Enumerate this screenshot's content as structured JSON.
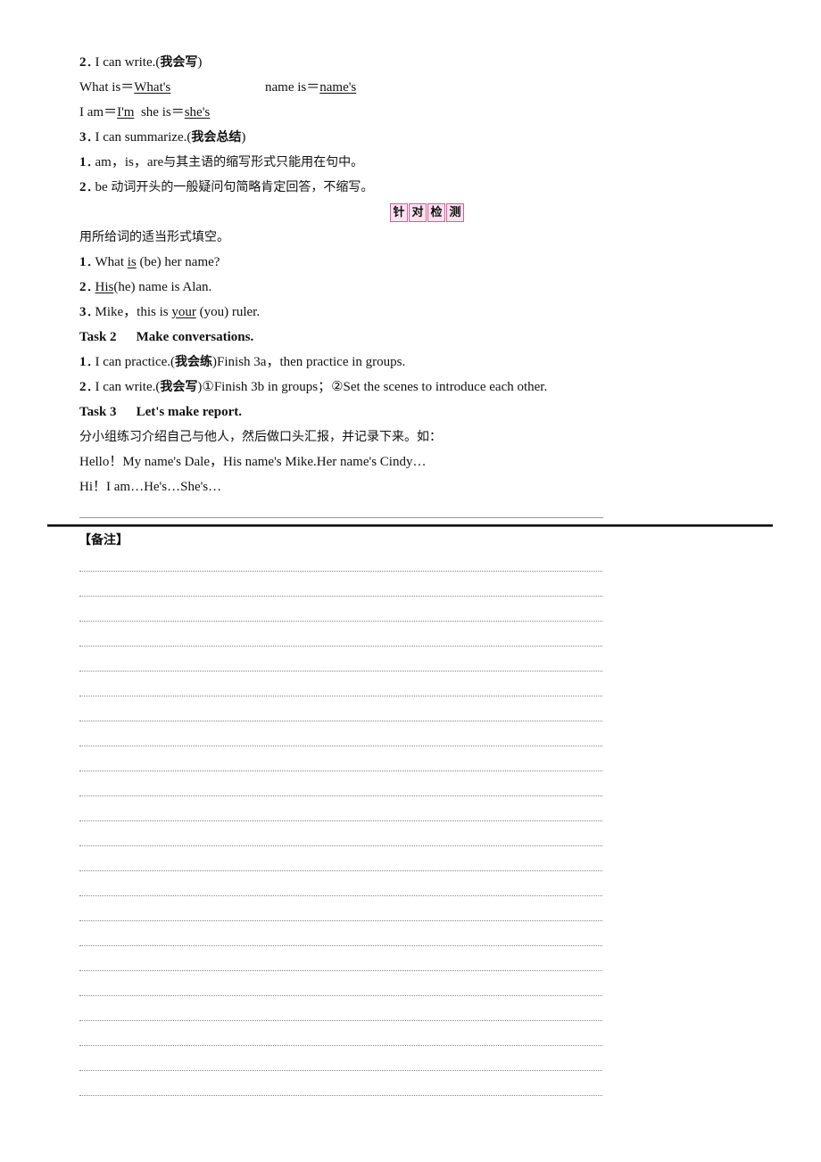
{
  "section_write": {
    "num": "2",
    "label": "I can write.(",
    "label_cn": "我会写",
    "label_end": ")",
    "pairs_row1": [
      {
        "full": "What is＝",
        "short": "What's"
      },
      {
        "full": "name is＝",
        "short": "name's"
      }
    ],
    "pairs_row2": [
      {
        "full": "I am＝",
        "short": "I'm"
      },
      {
        "full": "she is＝",
        "short": "she's"
      }
    ]
  },
  "section_summarize": {
    "num": "3",
    "label": "I can summarize.(",
    "label_cn": "我会总结",
    "label_end": ")",
    "points": [
      {
        "num": "1",
        "text_en": "am，is，are",
        "text_cn": "与其主语的缩写形式只能用在句中。"
      },
      {
        "num": "2",
        "text_en": "be",
        "text_cn": "动词开头的一般疑问句简略肯定回答，不缩写。"
      }
    ]
  },
  "badge": {
    "chars": [
      "针",
      "对",
      "检",
      "测"
    ],
    "border_color": "#e05a9a",
    "bg_color": "#fbe3ef"
  },
  "exercise": {
    "instruction": "用所给词的适当形式填空。",
    "items": [
      {
        "num": "1",
        "before": "What ",
        "answer": "is",
        "after": " (be) her name?"
      },
      {
        "num": "2",
        "before": "",
        "answer": "His",
        "after": "(he) name is Alan."
      },
      {
        "num": "3",
        "before": "Mike，this is ",
        "answer": "your",
        "after": " (you) ruler."
      }
    ]
  },
  "task2": {
    "title": "Task 2",
    "subtitle": "Make conversations.",
    "items": [
      {
        "num": "1",
        "lead": "I can practice.(",
        "cn": "我会练",
        "rest": ")Finish 3a，then practice in groups."
      },
      {
        "num": "2",
        "lead": "I can write.(",
        "cn": "我会写",
        "rest": ")①Finish 3b in groups；②Set the scenes to introduce each other."
      }
    ]
  },
  "task3": {
    "title": "Task 3",
    "subtitle": "Let's make report.",
    "instruction": "分小组练习介绍自己与他人，然后做口头汇报，并记录下来。如：",
    "example1": "Hello！My name's Dale，His name's Mike.Her name's Cindy…",
    "example2": "Hi！I am…He's…She's…"
  },
  "notes": {
    "title": "【备注】",
    "line_count": 22
  }
}
